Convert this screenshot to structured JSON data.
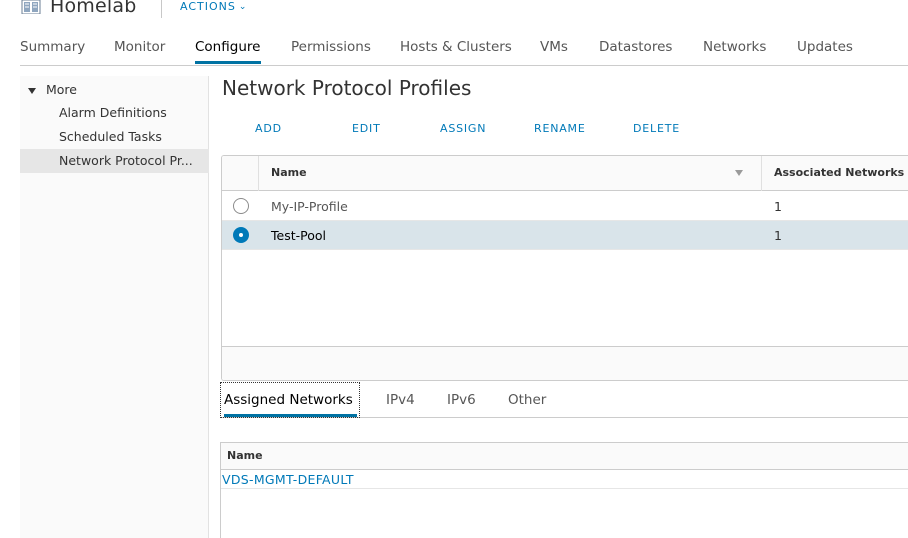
{
  "header": {
    "icon": "datacenter-icon",
    "title": "Homelab",
    "actions_label": "ACTIONS",
    "actions_chevron": "⌄"
  },
  "tabs": [
    {
      "label": "Summary"
    },
    {
      "label": "Monitor"
    },
    {
      "label": "Configure",
      "active": true
    },
    {
      "label": "Permissions"
    },
    {
      "label": "Hosts & Clusters"
    },
    {
      "label": "VMs"
    },
    {
      "label": "Datastores"
    },
    {
      "label": "Networks"
    },
    {
      "label": "Updates"
    }
  ],
  "sidebar": {
    "group_label": "More",
    "items": [
      {
        "label": "Alarm Definitions"
      },
      {
        "label": "Scheduled Tasks"
      },
      {
        "label": "Network Protocol Pr...",
        "selected": true
      }
    ]
  },
  "main": {
    "title": "Network Protocol Profiles",
    "toolbar": {
      "add": "ADD",
      "edit": "EDIT",
      "assign": "ASSIGN",
      "rename": "RENAME",
      "delete": "DELETE"
    },
    "grid": {
      "columns": [
        "Name",
        "Associated Networks Cou"
      ],
      "rows": [
        {
          "name": "My-IP-Profile",
          "count": "1",
          "selected": false
        },
        {
          "name": "Test-Pool",
          "count": "1",
          "selected": true
        }
      ]
    },
    "detail_tabs": [
      {
        "label": "Assigned Networks",
        "active": true
      },
      {
        "label": "IPv4"
      },
      {
        "label": "IPv6"
      },
      {
        "label": "Other"
      }
    ],
    "assigned_networks": {
      "column": "Name",
      "rows": [
        {
          "name": "VDS-MGMT-DEFAULT"
        }
      ]
    }
  },
  "colors": {
    "accent": "#0079b8",
    "selected_row": "#d9e4ea",
    "tab_underline": "#0072a3"
  }
}
